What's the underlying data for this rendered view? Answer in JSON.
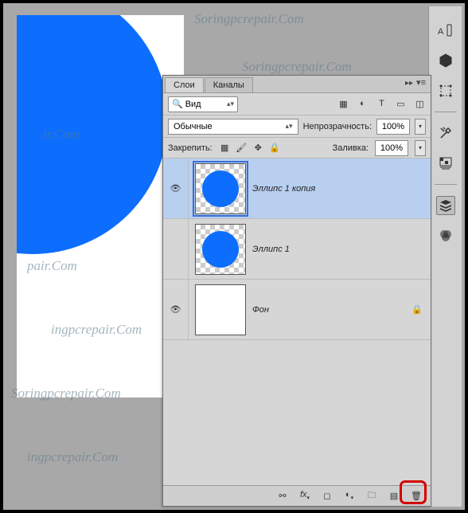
{
  "panel": {
    "tabs": {
      "layers": "Слои",
      "channels": "Каналы"
    },
    "search_label": "Вид",
    "blend_mode": "Обычные",
    "opacity_label": "Непрозрачность:",
    "opacity_value": "100%",
    "lock_label": "Закрепить:",
    "fill_label": "Заливка:",
    "fill_value": "100%"
  },
  "layers": [
    {
      "name": "Эллипс 1 копия",
      "visible": true,
      "selected": true,
      "shape": "circle",
      "locked": false
    },
    {
      "name": "Эллипс 1",
      "visible": false,
      "selected": false,
      "shape": "circle",
      "locked": false
    },
    {
      "name": "Фон",
      "visible": true,
      "selected": false,
      "shape": "blank",
      "locked": true
    }
  ],
  "footer_icons": [
    "link",
    "fx",
    "mask",
    "adjust",
    "group",
    "new",
    "trash"
  ],
  "right_tools": [
    "character",
    "3d",
    "transform",
    "swatches",
    "adjustments",
    "layers-icon",
    "channels-icon"
  ]
}
